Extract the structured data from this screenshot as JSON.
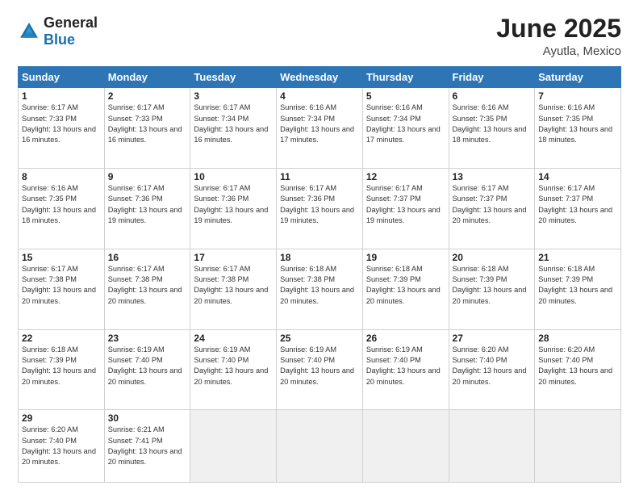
{
  "logo": {
    "general": "General",
    "blue": "Blue"
  },
  "header": {
    "month": "June 2025",
    "location": "Ayutla, Mexico"
  },
  "weekdays": [
    "Sunday",
    "Monday",
    "Tuesday",
    "Wednesday",
    "Thursday",
    "Friday",
    "Saturday"
  ],
  "weeks": [
    [
      {
        "day": "1",
        "sunrise": "6:17 AM",
        "sunset": "7:33 PM",
        "daylight": "13 hours and 16 minutes."
      },
      {
        "day": "2",
        "sunrise": "6:17 AM",
        "sunset": "7:33 PM",
        "daylight": "13 hours and 16 minutes."
      },
      {
        "day": "3",
        "sunrise": "6:17 AM",
        "sunset": "7:34 PM",
        "daylight": "13 hours and 16 minutes."
      },
      {
        "day": "4",
        "sunrise": "6:16 AM",
        "sunset": "7:34 PM",
        "daylight": "13 hours and 17 minutes."
      },
      {
        "day": "5",
        "sunrise": "6:16 AM",
        "sunset": "7:34 PM",
        "daylight": "13 hours and 17 minutes."
      },
      {
        "day": "6",
        "sunrise": "6:16 AM",
        "sunset": "7:35 PM",
        "daylight": "13 hours and 18 minutes."
      },
      {
        "day": "7",
        "sunrise": "6:16 AM",
        "sunset": "7:35 PM",
        "daylight": "13 hours and 18 minutes."
      }
    ],
    [
      {
        "day": "8",
        "sunrise": "6:16 AM",
        "sunset": "7:35 PM",
        "daylight": "13 hours and 18 minutes."
      },
      {
        "day": "9",
        "sunrise": "6:17 AM",
        "sunset": "7:36 PM",
        "daylight": "13 hours and 19 minutes."
      },
      {
        "day": "10",
        "sunrise": "6:17 AM",
        "sunset": "7:36 PM",
        "daylight": "13 hours and 19 minutes."
      },
      {
        "day": "11",
        "sunrise": "6:17 AM",
        "sunset": "7:36 PM",
        "daylight": "13 hours and 19 minutes."
      },
      {
        "day": "12",
        "sunrise": "6:17 AM",
        "sunset": "7:37 PM",
        "daylight": "13 hours and 19 minutes."
      },
      {
        "day": "13",
        "sunrise": "6:17 AM",
        "sunset": "7:37 PM",
        "daylight": "13 hours and 20 minutes."
      },
      {
        "day": "14",
        "sunrise": "6:17 AM",
        "sunset": "7:37 PM",
        "daylight": "13 hours and 20 minutes."
      }
    ],
    [
      {
        "day": "15",
        "sunrise": "6:17 AM",
        "sunset": "7:38 PM",
        "daylight": "13 hours and 20 minutes."
      },
      {
        "day": "16",
        "sunrise": "6:17 AM",
        "sunset": "7:38 PM",
        "daylight": "13 hours and 20 minutes."
      },
      {
        "day": "17",
        "sunrise": "6:17 AM",
        "sunset": "7:38 PM",
        "daylight": "13 hours and 20 minutes."
      },
      {
        "day": "18",
        "sunrise": "6:18 AM",
        "sunset": "7:38 PM",
        "daylight": "13 hours and 20 minutes."
      },
      {
        "day": "19",
        "sunrise": "6:18 AM",
        "sunset": "7:39 PM",
        "daylight": "13 hours and 20 minutes."
      },
      {
        "day": "20",
        "sunrise": "6:18 AM",
        "sunset": "7:39 PM",
        "daylight": "13 hours and 20 minutes."
      },
      {
        "day": "21",
        "sunrise": "6:18 AM",
        "sunset": "7:39 PM",
        "daylight": "13 hours and 20 minutes."
      }
    ],
    [
      {
        "day": "22",
        "sunrise": "6:18 AM",
        "sunset": "7:39 PM",
        "daylight": "13 hours and 20 minutes."
      },
      {
        "day": "23",
        "sunrise": "6:19 AM",
        "sunset": "7:40 PM",
        "daylight": "13 hours and 20 minutes."
      },
      {
        "day": "24",
        "sunrise": "6:19 AM",
        "sunset": "7:40 PM",
        "daylight": "13 hours and 20 minutes."
      },
      {
        "day": "25",
        "sunrise": "6:19 AM",
        "sunset": "7:40 PM",
        "daylight": "13 hours and 20 minutes."
      },
      {
        "day": "26",
        "sunrise": "6:19 AM",
        "sunset": "7:40 PM",
        "daylight": "13 hours and 20 minutes."
      },
      {
        "day": "27",
        "sunrise": "6:20 AM",
        "sunset": "7:40 PM",
        "daylight": "13 hours and 20 minutes."
      },
      {
        "day": "28",
        "sunrise": "6:20 AM",
        "sunset": "7:40 PM",
        "daylight": "13 hours and 20 minutes."
      }
    ],
    [
      {
        "day": "29",
        "sunrise": "6:20 AM",
        "sunset": "7:40 PM",
        "daylight": "13 hours and 20 minutes."
      },
      {
        "day": "30",
        "sunrise": "6:21 AM",
        "sunset": "7:41 PM",
        "daylight": "13 hours and 20 minutes."
      },
      null,
      null,
      null,
      null,
      null
    ]
  ],
  "labels": {
    "sunrise": "Sunrise:",
    "sunset": "Sunset:",
    "daylight": "Daylight:"
  }
}
